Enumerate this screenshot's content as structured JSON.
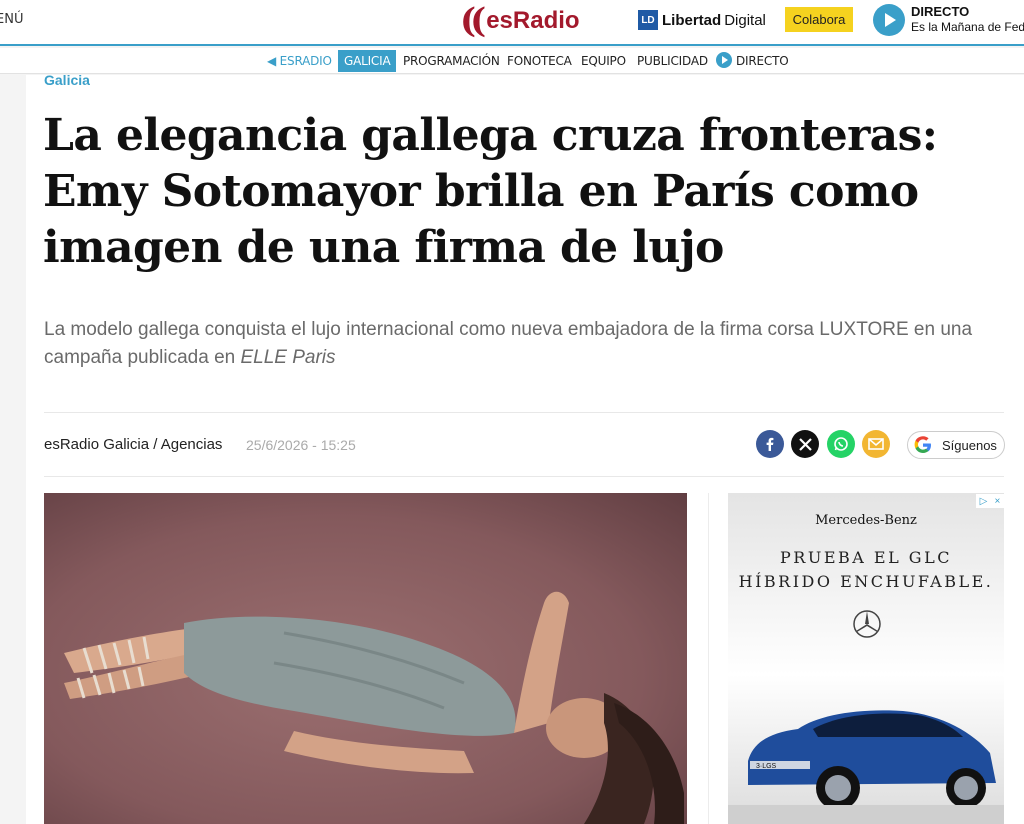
{
  "header": {
    "menu_label": "ENÚ",
    "logo_paren": "((",
    "logo_name": "esRadio",
    "partner_mark": "LD",
    "partner_name_bold": "Libertad",
    "partner_name_rest": "Digital",
    "colabora_label": "Colabora",
    "live_title": "DIRECTO",
    "live_show": "Es la Mañana de Fed"
  },
  "subnav": {
    "back_label": "◀ ESRADIO",
    "items": [
      "GALICIA",
      "PROGRAMACIÓN",
      "FONOTECA",
      "EQUIPO",
      "PUBLICIDAD"
    ],
    "live_label": "DIRECTO"
  },
  "article": {
    "section": "Galicia",
    "headline": "La elegancia gallega cruza fronteras: Emy Sotomayor brilla en París como imagen de una firma de lujo",
    "subtitle_main": "La modelo gallega conquista el lujo internacional como nueva embajadora de la firma corsa LUXTORE en una campaña publicada en ",
    "subtitle_italic": "ELLE Paris",
    "author": "esRadio Galicia / Agencias",
    "date": "25/6/2026 - 15:25",
    "share_icons": [
      "facebook-icon",
      "x-icon",
      "whatsapp-icon",
      "email-icon"
    ],
    "follow_label": "Síguenos"
  },
  "ad": {
    "brand": "Mercedes-Benz",
    "line1": "PRUEBA EL GLC",
    "line2": "HÍBRIDO ENCHUFABLE.",
    "plate": "3·LGS"
  },
  "colors": {
    "accent": "#3a9fc9",
    "brand": "#a3192c",
    "colabora": "#f5d21f"
  }
}
